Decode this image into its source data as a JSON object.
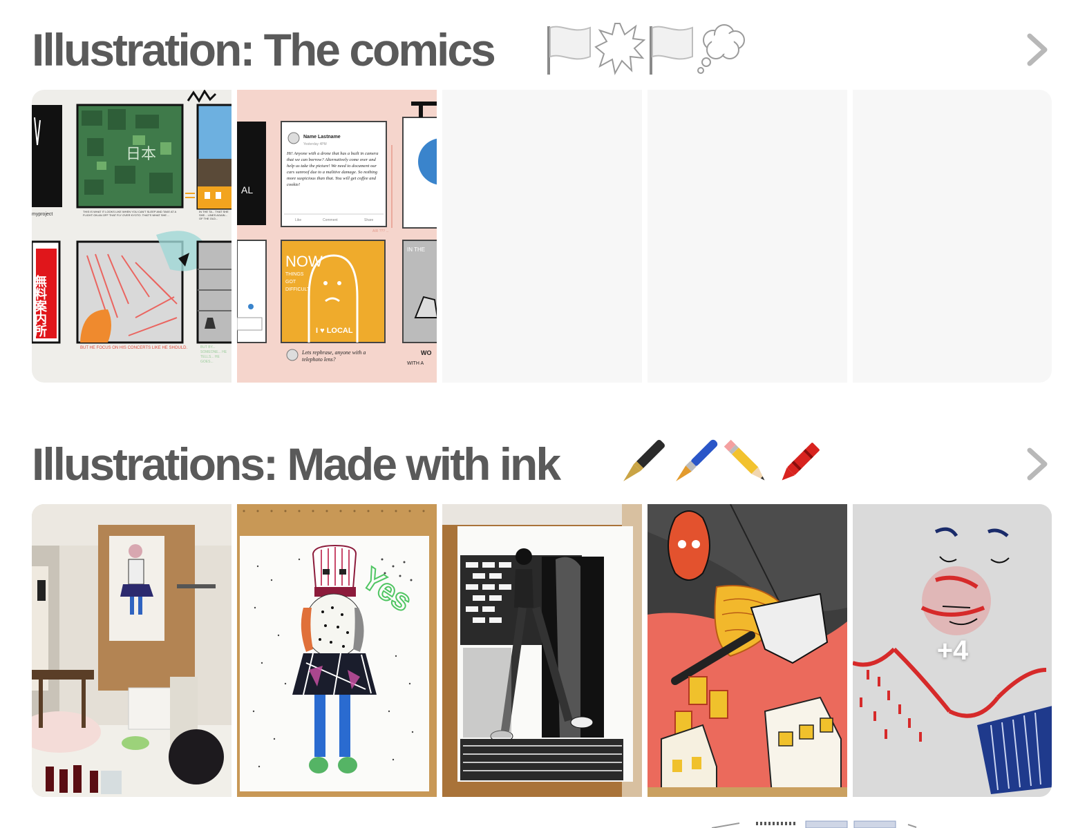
{
  "sections": [
    {
      "title": "Illustration: The comics",
      "emoji_icons": [
        "white-flag-icon",
        "speech-burst-icon",
        "white-flag-icon",
        "thought-bubble-icon"
      ],
      "tiles": [
        {
          "kind": "comic-page",
          "captions": {
            "top_left_credit": "myproject",
            "middle_caption": "THIS IS WHAT IT LOOKS LIKE WHEN YOU CAN'T SLEEP AND TAKE AT A FLIGHT ON AN OFF THAT FLY OVER KYOTO. THAT'S WHAT SHE ...",
            "right_caption": "IN THE TA... THAT SHE SHE... LINES AGAIN... OF THE OLD...",
            "bottom_caption": "BUT HE FOCUS ON HIS CONCERTS LIKE HE SHOULD.",
            "bottom_right_caption": "BUT BY... SOMEONE... HE TELLS... HE GOES...",
            "kanji_map": "日本",
            "kanji_sign": "無料案内所"
          }
        },
        {
          "kind": "comic-page",
          "captions": {
            "post_name": "Name Lastname",
            "post_time": "Yesterday 4PM",
            "post_text": "Hi! Anyone with a drone that has a built in camera that we can borrow? Alternatively come over and help us take the picture! We need to document our cars sunroof due to a malitive damage. So nothing more suspicious than that. You will get coffee and cookie!",
            "like": "Like",
            "comment": "Comment",
            "share": "Share",
            "air_text": "AIR ??? ...",
            "now_label": "NOW",
            "things_got_difficult": "THINGS GOT DIFFICULT",
            "shirt_text": "I ♥ LOCAL",
            "reply_text": "Lets rephrase, anyone with a telephoto lens?",
            "in_the": "IN THE",
            "side_wo": "WO",
            "side_with": "WITH A"
          }
        },
        {
          "kind": "empty"
        },
        {
          "kind": "empty"
        },
        {
          "kind": "empty"
        }
      ]
    },
    {
      "title": "Illustrations: Made with ink",
      "emoji_icons": [
        "fountain-pen-icon",
        "paintbrush-icon",
        "pencil-icon",
        "crayon-icon"
      ],
      "tiles": [
        {
          "kind": "photo-studio"
        },
        {
          "kind": "photo-yes",
          "graffiti": "Yes"
        },
        {
          "kind": "photo-bw-figure"
        },
        {
          "kind": "photo-red-figure"
        },
        {
          "kind": "photo-face",
          "more_count": "+4"
        }
      ]
    }
  ],
  "colors": {
    "title": "#5a5a5a",
    "chevron": "#b8b8b8",
    "empty_tile": "#f7f7f7",
    "comic_pink": "#f5d5cc",
    "comic_orange": "#efab2c"
  }
}
